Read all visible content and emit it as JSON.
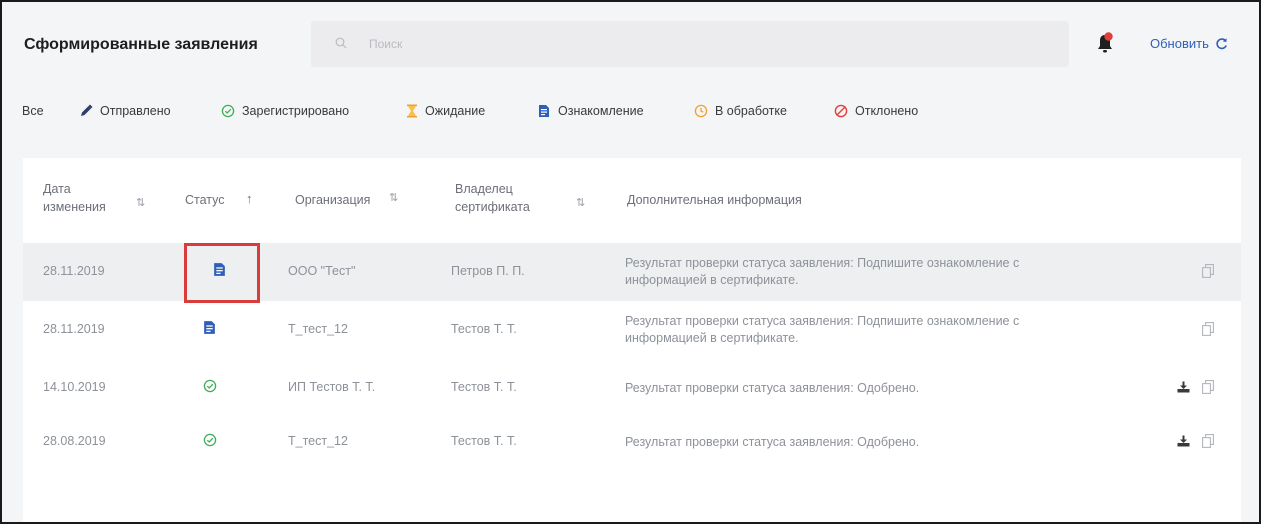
{
  "header": {
    "title": "Сформированные заявления",
    "search_placeholder": "Поиск",
    "refresh_label": "Обновить",
    "notification_badge": "1"
  },
  "filters": [
    {
      "label": "Все",
      "icon": "none"
    },
    {
      "label": "Отправлено",
      "icon": "pen-icon"
    },
    {
      "label": "Зарегистрировано",
      "icon": "check-circle-icon"
    },
    {
      "label": "Ожидание",
      "icon": "hourglass-icon"
    },
    {
      "label": "Ознакомление",
      "icon": "document-icon"
    },
    {
      "label": "В обработке",
      "icon": "clock-icon"
    },
    {
      "label": "Отклонено",
      "icon": "blocked-icon"
    }
  ],
  "table": {
    "columns": [
      {
        "line1": "Дата",
        "line2": "изменения"
      },
      {
        "line1": "Статус",
        "line2": ""
      },
      {
        "line1": "Организация",
        "line2": ""
      },
      {
        "line1": "Владелец",
        "line2": "сертификата"
      },
      {
        "line1": "Дополнительная информация",
        "line2": ""
      }
    ],
    "rows": [
      {
        "date": "28.11.2019",
        "status": "document-icon",
        "org": "ООО \"Тест\"",
        "owner": "Петров П. П.",
        "info1": "Результат проверки статуса заявления: Подпишите ознакомление с",
        "info2": "информацией в сертификате.",
        "selected": true
      },
      {
        "date": "28.11.2019",
        "status": "document-icon",
        "org": "Т_тест_12",
        "owner": "Тестов Т. Т.",
        "info1": "Результат проверки статуса заявления: Подпишите ознакомление с",
        "info2": "информацией в сертификате.",
        "selected": false
      },
      {
        "date": "14.10.2019",
        "status": "check-circle-icon",
        "org": "ИП Тестов Т. Т.",
        "owner": "Тестов Т. Т.",
        "info1": "Результат проверки статуса заявления: Одобрено.",
        "info2": "",
        "selected": false
      },
      {
        "date": "28.08.2019",
        "status": "check-circle-icon",
        "org": "Т_тест_12",
        "owner": "Тестов Т. Т.",
        "info1": "Результат проверки статуса заявления: Одобрено.",
        "info2": "",
        "selected": false
      }
    ]
  },
  "colors": {
    "accent_blue": "#2f5fb8",
    "status_green": "#3fae5a",
    "status_orange": "#f0a030",
    "status_red": "#e0403a",
    "highlight_red": "#d83c3c"
  }
}
